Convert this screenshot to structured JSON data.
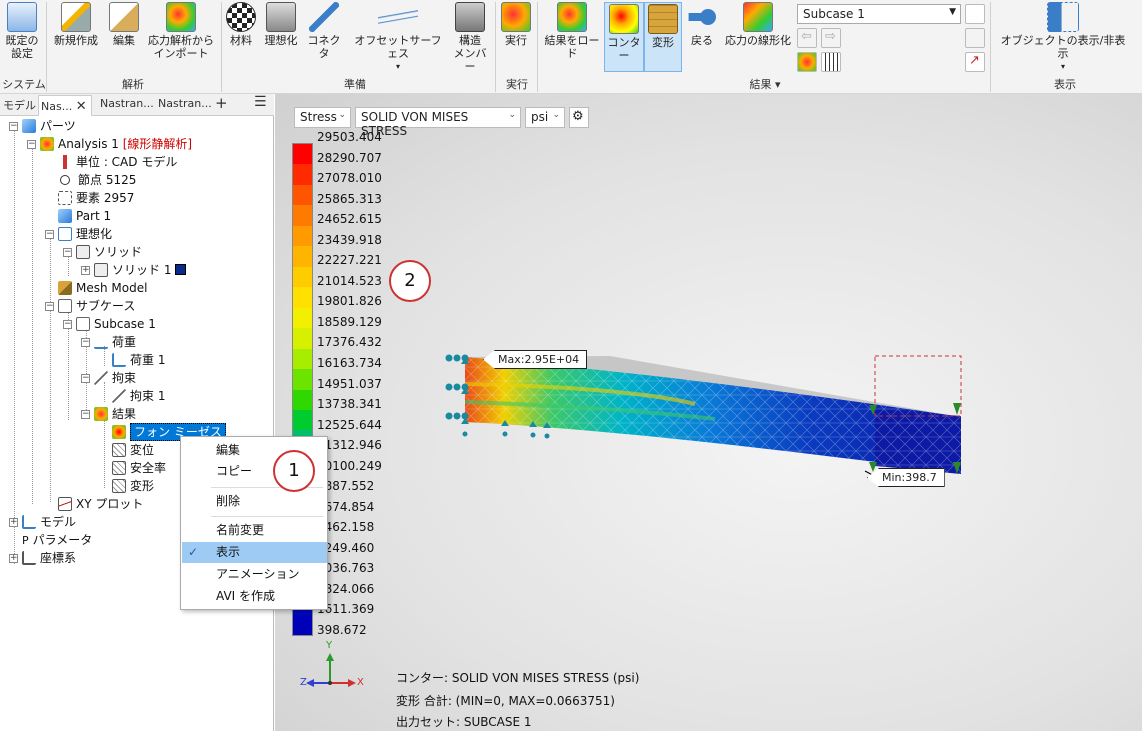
{
  "ribbon": {
    "buttons": {
      "default_settings": "既定の\n設定",
      "new": "新規作成",
      "edit": "編集",
      "import": "応力解析から\nインポート",
      "material": "材料",
      "idealize": "理想化",
      "connector": "コネクタ",
      "offset_surface": "オフセットサーフェス",
      "structural_member": "構造\nメンバー",
      "run": "実行",
      "load_results": "結果をロード",
      "contour": "コンター",
      "deform": "変形",
      "back": "戻る",
      "linearize": "応力の線形化",
      "show_hide": "オブジェクトの表示/非表示"
    },
    "groups": {
      "system": "システム",
      "analysis": "解析",
      "prepare": "準備",
      "run": "実行",
      "results": "結果",
      "display": "表示"
    },
    "subcase_select": "Subcase 1"
  },
  "tabs": [
    "モデル",
    "Nas...",
    "Nastran...",
    "Nastran..."
  ],
  "tree": {
    "parts": "パーツ",
    "analysis": "Analysis 1",
    "analysis_tag": "[線形静解析]",
    "units": "単位 : CAD モデル",
    "nodes": "節点 5125",
    "elements": "要素 2957",
    "part1": "Part 1",
    "idealization": "理想化",
    "solid": "ソリッド",
    "solid1": "ソリッド 1",
    "mesh_model": "Mesh Model",
    "subcases": "サブケース",
    "subcase1": "Subcase 1",
    "loads": "荷重",
    "load1": "荷重 1",
    "constraints": "拘束",
    "constraint1": "拘束 1",
    "results": "結果",
    "von_mises": "フォン ミーゼス",
    "displacement": "変位",
    "safety_factor": "安全率",
    "deformation": "変形",
    "xy_plot": "XY プロット",
    "model": "モデル",
    "parameters": "パラメータ",
    "coordinate_system": "座標系"
  },
  "context_menu": {
    "items": [
      "編集",
      "コピー",
      "削除",
      "名前変更",
      "表示",
      "アニメーション",
      "AVI を作成"
    ],
    "checked": "表示"
  },
  "viewport": {
    "result_type": "Stress",
    "component": "SOLID VON MISES STRESS",
    "unit": "psi",
    "legend_values": [
      "29503.404",
      "28290.707",
      "27078.010",
      "25865.313",
      "24652.615",
      "23439.918",
      "22227.221",
      "21014.523",
      "19801.826",
      "18589.129",
      "17376.432",
      "16163.734",
      "14951.037",
      "13738.341",
      "12525.644",
      "11312.946",
      "10100.249",
      "8887.552",
      "7674.854",
      "6462.158",
      "5249.460",
      "4036.763",
      "2824.066",
      "1611.369",
      "398.672"
    ],
    "legend_colors": [
      "#ff0000",
      "#ff2a00",
      "#ff5500",
      "#ff7a00",
      "#ff9a00",
      "#ffb400",
      "#ffcc00",
      "#ffe000",
      "#f2f000",
      "#d6f000",
      "#a8ec00",
      "#6ce400",
      "#2ed800",
      "#00cc30",
      "#00c070",
      "#00b8a8",
      "#00a8d8",
      "#0090ff",
      "#0070f0",
      "#0050e6",
      "#0032d8",
      "#0018cc",
      "#0008c0",
      "#0000b8"
    ],
    "max_label": "Max:2.95E+04",
    "min_label": "Min:398.7",
    "caption_contour": "コンター: SOLID VON MISES STRESS (psi)",
    "caption_deform": "変形 合計: (MIN=0, MAX=0.0663751)",
    "caption_output": "出力セット: SUBCASE 1",
    "axis_y": "Y",
    "axis_z": "Z",
    "axis_x": "X"
  },
  "callouts": [
    "1",
    "2"
  ]
}
